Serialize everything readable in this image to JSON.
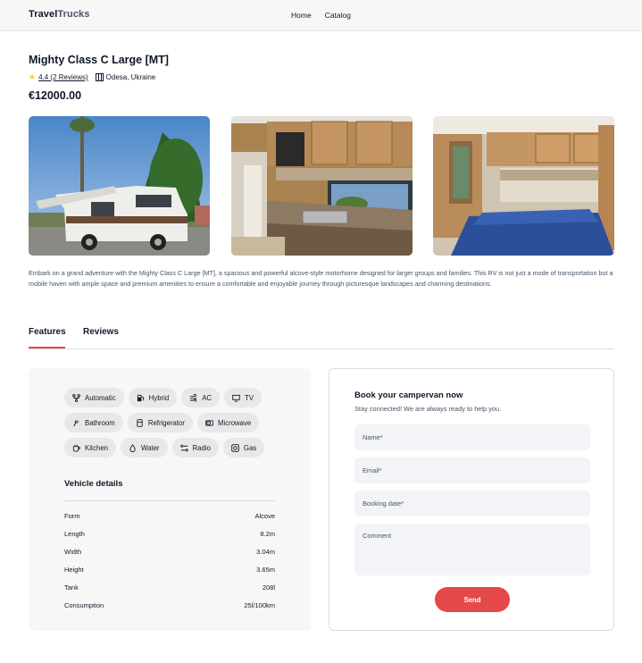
{
  "header": {
    "logo_part1": "Travel",
    "logo_part2": "Trucks",
    "nav": [
      {
        "label": "Home"
      },
      {
        "label": "Catalog"
      }
    ]
  },
  "camper": {
    "name": "Mighty Class C Large [MT]",
    "rating_text": "4.4 (2 Reviews)",
    "location": "Odesa, Ukraine",
    "price": "€12000.00",
    "description": "Embark on a grand adventure with the Mighty Class C Large [MT], a spacious and powerful alcove-style motorhome designed for larger groups and families. This RV is not just a mode of transportation but a mobile haven with ample space and premium amenities to ensure a comfortable and enjoyable journey through picturesque landscapes and charming destinations."
  },
  "photos": [
    {
      "icon": "rv-exterior-photo"
    },
    {
      "icon": "kitchen-photo"
    },
    {
      "icon": "bedroom-photo"
    }
  ],
  "tabs": [
    {
      "label": "Features"
    },
    {
      "label": "Reviews"
    }
  ],
  "features": [
    {
      "label": "Automatic",
      "icon": "gear-icon"
    },
    {
      "label": "Hybrid",
      "icon": "fuel-icon"
    },
    {
      "label": "AC",
      "icon": "wind-icon"
    },
    {
      "label": "TV",
      "icon": "tv-icon"
    },
    {
      "label": "Bathroom",
      "icon": "shower-icon"
    },
    {
      "label": "Refrigerator",
      "icon": "fridge-icon"
    },
    {
      "label": "Microwave",
      "icon": "microwave-icon"
    },
    {
      "label": "Kitchen",
      "icon": "cup-icon"
    },
    {
      "label": "Water",
      "icon": "drop-icon"
    },
    {
      "label": "Radio",
      "icon": "radio-icon"
    },
    {
      "label": "Gas",
      "icon": "gas-icon"
    }
  ],
  "vehicle_details": {
    "title": "Vehicle details",
    "rows": [
      {
        "label": "Form",
        "value": "Alcove"
      },
      {
        "label": "Length",
        "value": "8.2m"
      },
      {
        "label": "Width",
        "value": "3.04m"
      },
      {
        "label": "Height",
        "value": "3.65m"
      },
      {
        "label": "Tank",
        "value": "208l"
      },
      {
        "label": "Consumption",
        "value": "25l/100km"
      }
    ]
  },
  "booking": {
    "title": "Book your campervan now",
    "subtitle": "Stay connected! We are always ready to help you.",
    "name_placeholder": "Name*",
    "email_placeholder": "Email*",
    "date_placeholder": "Booking date*",
    "comment_placeholder": "Comment",
    "send_label": "Send"
  },
  "colors": {
    "accent": "#e44848",
    "star": "#ffc531",
    "panel": "#f7f7f7"
  }
}
